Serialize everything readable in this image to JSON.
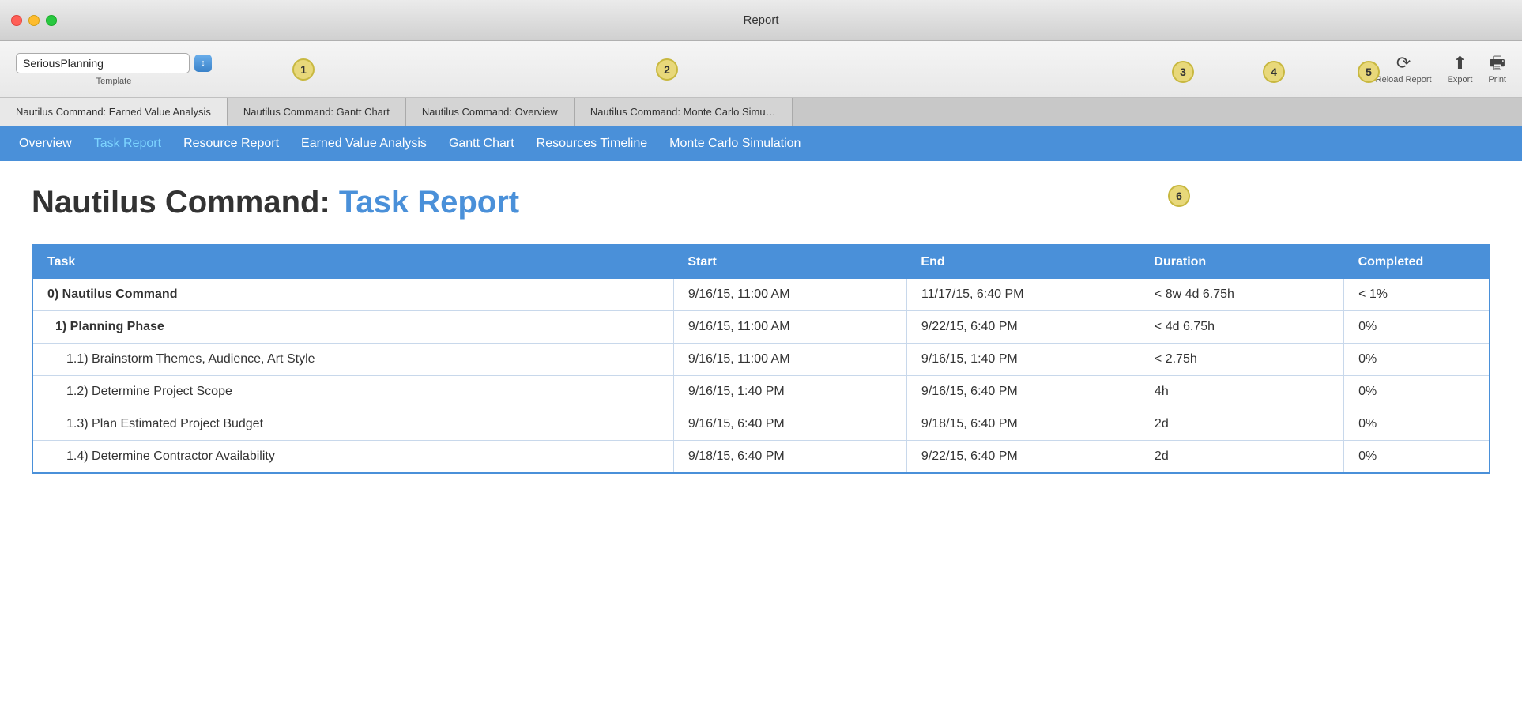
{
  "window": {
    "title": "Report"
  },
  "toolbar": {
    "template_value": "SeriousPlanning",
    "template_label": "Template",
    "reload_label": "Reload Report",
    "export_label": "Export",
    "print_label": "Print"
  },
  "os_tabs": [
    {
      "label": "Nautilus Command: Earned Value Analysis"
    },
    {
      "label": "Nautilus Command: Gantt Chart"
    },
    {
      "label": "Nautilus Command: Overview"
    },
    {
      "label": "Nautilus Command: Monte Carlo Simu…"
    }
  ],
  "report_nav": [
    {
      "label": "Overview",
      "active": false
    },
    {
      "label": "Task Report",
      "active": true
    },
    {
      "label": "Resource Report",
      "active": false
    },
    {
      "label": "Earned Value Analysis",
      "active": false
    },
    {
      "label": "Gantt Chart",
      "active": false
    },
    {
      "label": "Resources Timeline",
      "active": false
    },
    {
      "label": "Monte Carlo Simulation",
      "active": false
    }
  ],
  "report": {
    "title_black": "Nautilus Command:",
    "title_blue": "Task Report",
    "columns": [
      "Task",
      "Start",
      "End",
      "Duration",
      "Completed"
    ],
    "rows": [
      {
        "task": "0) Nautilus Command",
        "start": "9/16/15, 11:00 AM",
        "end": "11/17/15, 6:40 PM",
        "duration": "< 8w 4d 6.75h",
        "completed": "< 1%",
        "indent": 0,
        "bold": true
      },
      {
        "task": "1) Planning Phase",
        "start": "9/16/15, 11:00 AM",
        "end": "9/22/15, 6:40 PM",
        "duration": "< 4d 6.75h",
        "completed": "0%",
        "indent": 1,
        "bold": true
      },
      {
        "task": "1.1) Brainstorm Themes, Audience, Art Style",
        "start": "9/16/15, 11:00 AM",
        "end": "9/16/15, 1:40 PM",
        "duration": "< 2.75h",
        "completed": "0%",
        "indent": 2,
        "bold": false
      },
      {
        "task": "1.2) Determine Project Scope",
        "start": "9/16/15, 1:40 PM",
        "end": "9/16/15, 6:40 PM",
        "duration": "4h",
        "completed": "0%",
        "indent": 2,
        "bold": false
      },
      {
        "task": "1.3) Plan Estimated Project Budget",
        "start": "9/16/15, 6:40 PM",
        "end": "9/18/15, 6:40 PM",
        "duration": "2d",
        "completed": "0%",
        "indent": 2,
        "bold": false
      },
      {
        "task": "1.4) Determine Contractor Availability",
        "start": "9/18/15, 6:40 PM",
        "end": "9/22/15, 6:40 PM",
        "duration": "2d",
        "completed": "0%",
        "indent": 2,
        "bold": false
      }
    ]
  },
  "badges": [
    "1",
    "2",
    "3",
    "4",
    "5",
    "6"
  ]
}
